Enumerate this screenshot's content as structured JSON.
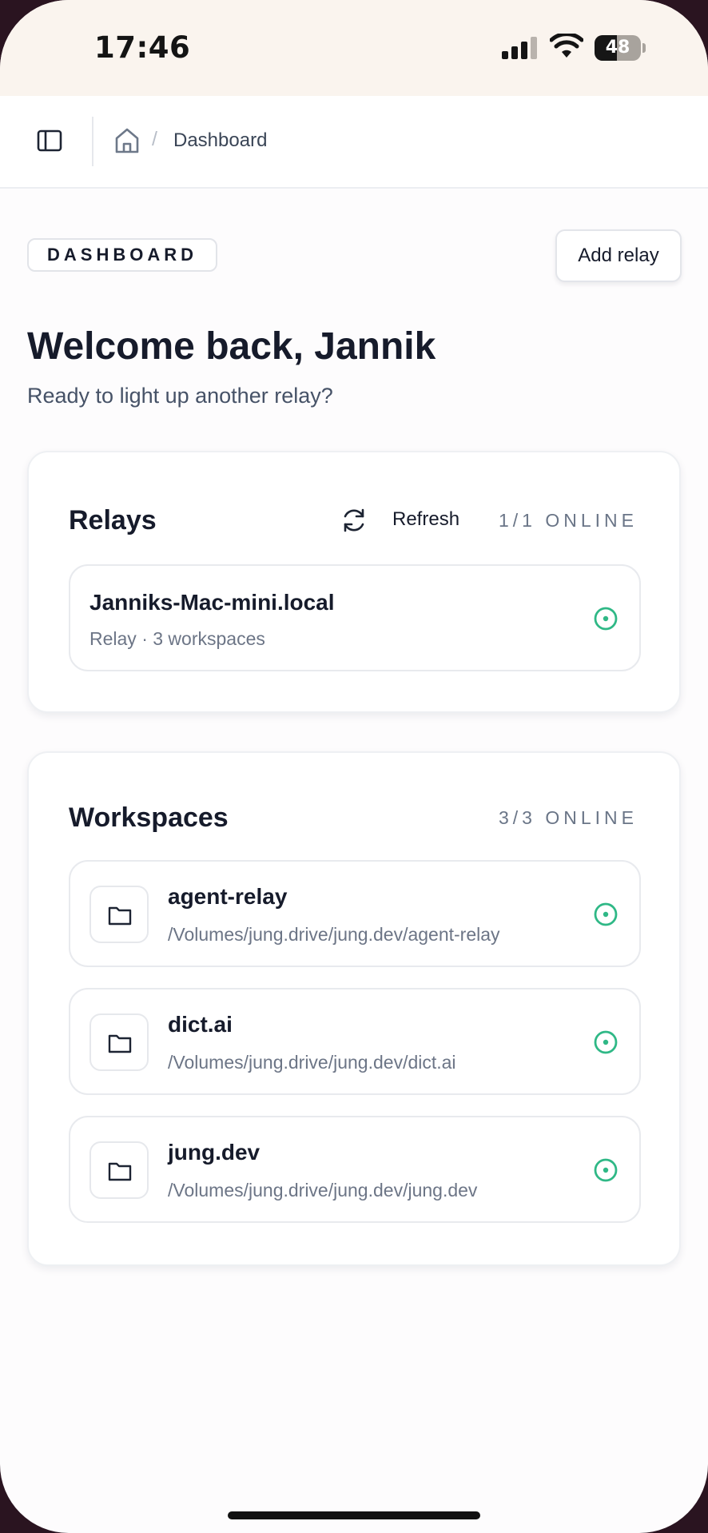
{
  "status_bar": {
    "time": "17:46",
    "battery": "48",
    "battery_level": 0.48
  },
  "nav": {
    "breadcrumb_current": "Dashboard",
    "breadcrumb_separator": "/",
    "icons": [
      "sidebar-toggle-icon",
      "home-icon"
    ]
  },
  "header": {
    "badge": "DASHBOARD",
    "add_relay": "Add relay",
    "welcome": "Welcome back, Jannik",
    "subtitle": "Ready to light up another relay?"
  },
  "relays": {
    "title": "Relays",
    "refresh_label": "Refresh",
    "online": "1/1 ONLINE",
    "items": [
      {
        "name": "Janniks-Mac-mini.local",
        "meta": "Relay · 3 workspaces",
        "status": "online"
      }
    ]
  },
  "workspaces": {
    "title": "Workspaces",
    "online": "3/3 ONLINE",
    "items": [
      {
        "name": "agent-relay",
        "path": "/Volumes/jung.drive/jung.dev/agent-relay",
        "status": "online"
      },
      {
        "name": "dict.ai",
        "path": "/Volumes/jung.drive/jung.dev/dict.ai",
        "status": "online"
      },
      {
        "name": "jung.dev",
        "path": "/Volumes/jung.drive/jung.dev/jung.dev",
        "status": "online"
      }
    ]
  },
  "colors": {
    "accent_online": "#2fb886",
    "text_primary": "#161b2b",
    "status_bar_bg": "#faf4ee"
  }
}
